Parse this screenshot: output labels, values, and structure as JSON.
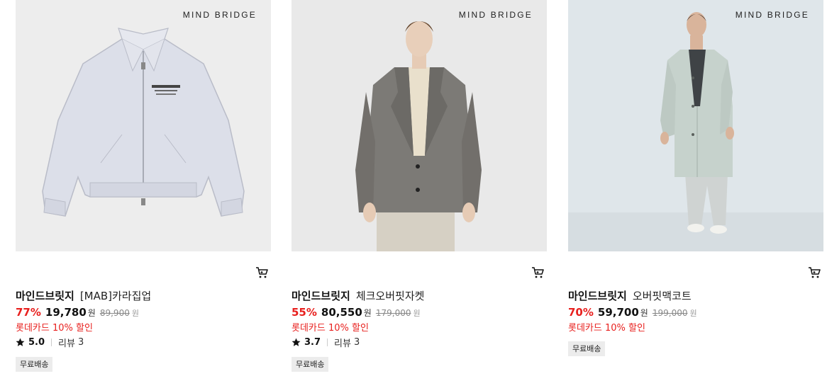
{
  "products": [
    {
      "brand_mark": "MIND BRIDGE",
      "brand": "마인드브릿지",
      "name": "[MAB]카라집업",
      "discount": "77%",
      "price": "19,780",
      "currency": "원",
      "original_price": "89,900",
      "card_promo": "롯데카드 10% 할인",
      "rating": "5.0",
      "review_label": "리뷰",
      "review_count": "3",
      "tag": "무료배송",
      "image_bg": "#ededed"
    },
    {
      "brand_mark": "MIND BRIDGE",
      "brand": "마인드브릿지",
      "name": "체크오버핏자켓",
      "discount": "55%",
      "price": "80,550",
      "currency": "원",
      "original_price": "179,000",
      "card_promo": "롯데카드 10% 할인",
      "rating": "3.7",
      "review_label": "리뷰",
      "review_count": "3",
      "tag": "무료배송",
      "image_bg": "#e9e9e9"
    },
    {
      "brand_mark": "MIND BRIDGE",
      "brand": "마인드브릿지",
      "name": "오버핏맥코트",
      "discount": "70%",
      "price": "59,700",
      "currency": "원",
      "original_price": "199,000",
      "card_promo": "롯데카드 10% 할인",
      "tag": "무료배송",
      "image_bg": "#dfe6ea"
    }
  ],
  "icons": {
    "cart": "cart-icon",
    "star": "star-icon"
  },
  "colors": {
    "discount": "#e8201e",
    "promo": "#e8201e",
    "tag_bg": "#ececec"
  }
}
